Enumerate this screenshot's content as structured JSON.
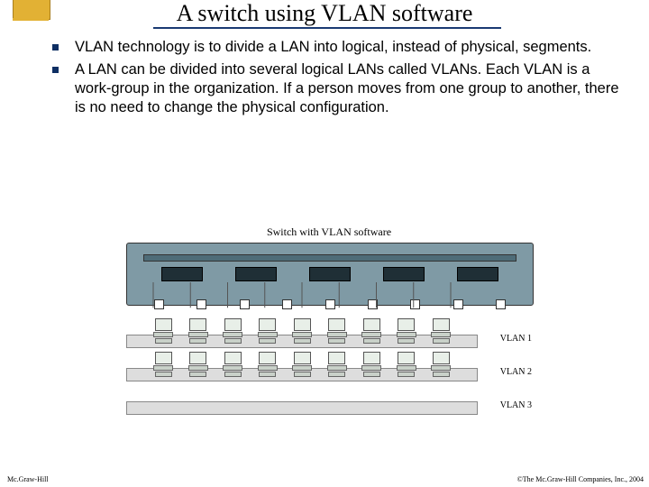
{
  "title": "A switch using VLAN software",
  "bullets": [
    "VLAN technology is to divide a LAN into logical, instead of physical, segments.",
    "A LAN can be divided into several logical LANs called VLANs. Each VLAN is a work-group in the organization. If a person moves from one group to another, there is no need to change the physical configuration."
  ],
  "figure": {
    "caption": "Switch with VLAN software",
    "slot_count": 5,
    "port_count": 9,
    "lans": [
      {
        "label": "VLAN 1",
        "pc_count": 9
      },
      {
        "label": "VLAN 2",
        "pc_count": 9
      },
      {
        "label": "VLAN 3",
        "pc_count": 0
      }
    ]
  },
  "footer": {
    "left": "Mc.Graw-Hill",
    "right": "©The Mc.Graw-Hill Companies, Inc., 2004"
  }
}
